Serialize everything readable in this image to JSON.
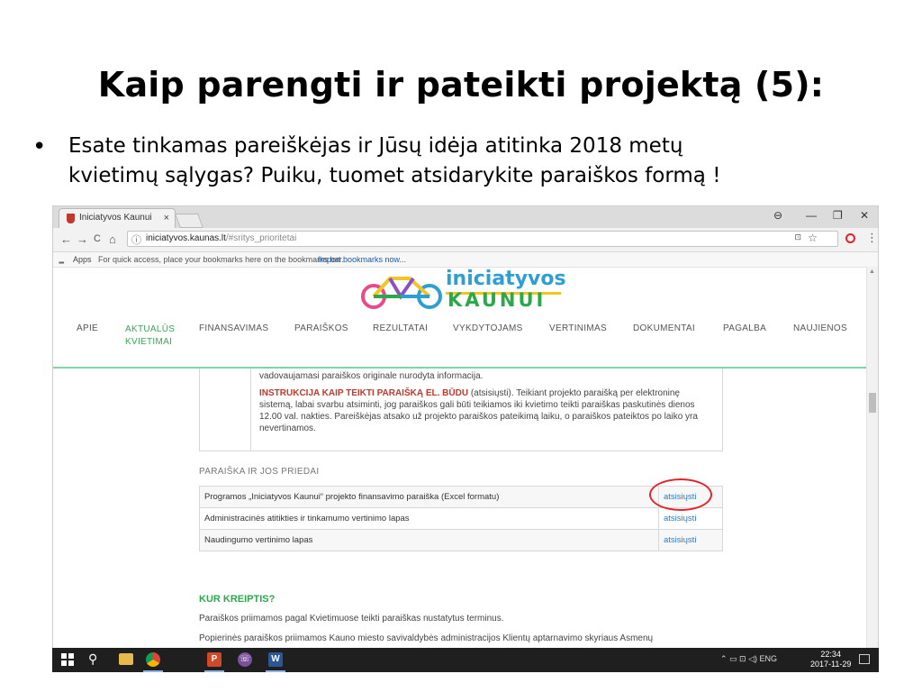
{
  "slide": {
    "title": "Kaip parengti ir pateikti projektą (5):",
    "bullet_symbol": "•",
    "bullet_line1": "Esate tinkamas pareiškėjas ir Jūsų idėja atitinka 2018 metų",
    "bullet_line2": "kvietimų sąlygas?  Puiku, tuomet atsidarykite paraiškos formą !"
  },
  "browser": {
    "tab_title": "Iniciatyvos Kaunui",
    "tab_close": "×",
    "window_controls": [
      "⊖",
      "—",
      "❐",
      "✕"
    ],
    "back": "←",
    "forward": "→",
    "reload": "C",
    "home": "⌂",
    "info_icon": "ⓘ",
    "url_host": "iniciatyvos.kaunas.lt",
    "url_path": "/#sritys_prioritetai",
    "translate_icon": "⊡",
    "star": "☆",
    "menu": "⋮",
    "bookmarks": {
      "apps_icon": "▪▪▪",
      "apps_label": "Apps",
      "hint": "For quick access, place your bookmarks here on the bookmarks bar.",
      "import": "Import bookmarks now..."
    }
  },
  "site": {
    "logo_line1": "iniciatyvos",
    "logo_line2": "KAUNUI",
    "nav": [
      {
        "label": "APIE"
      },
      {
        "label_line1": "AKTUALŪS",
        "label_line2": "KVIETIMAI"
      },
      {
        "label": "FINANSAVIMAS"
      },
      {
        "label": "PARAIŠKOS"
      },
      {
        "label": "REZULTATAI"
      },
      {
        "label": "VYKDYTOJAMS"
      },
      {
        "label": "VERTINIMAS"
      },
      {
        "label": "DOKUMENTAI"
      },
      {
        "label": "PAGALBA"
      },
      {
        "label": "NAUJIENOS"
      }
    ],
    "info": {
      "line1": "vadovaujamasi paraiškos originale nurodyta informacija.",
      "instr_title": "INSTRUKCIJA KAIP TEIKTI PARAIŠKĄ EL. BŪDU",
      "instr_link": " (atsisiųsti).",
      "instr_rest": " Teikiant projekto paraišką per elektroninę sistemą, labai svarbu atsiminti, jog paraiškos gali būti teikiamos iki kvietimo teikti paraiškas paskutinės dienos 12.00 val. nakties. Pareiškėjas atsako už projekto paraiškos pateikimą laiku, o paraiškos pateiktos po laiko yra nevertinamos."
    },
    "section_title": "PARAIŠKA IR JOS PRIEDAI",
    "files": [
      {
        "name": "Programos „Iniciatyvos Kaunui“ projekto finansavimo paraiška (Excel formatu)",
        "link": "atsisiųsti"
      },
      {
        "name": "Administracinės atitikties ir tinkamumo vertinimo lapas",
        "link": "atsisiųsti"
      },
      {
        "name": "Naudingumo vertinimo lapas",
        "link": "atsisiųsti"
      }
    ],
    "kur_title": "KUR KREIPTIS?",
    "para1": "Paraiškos priimamos pagal Kvietimuose teikti paraiškas nustatytus terminus.",
    "para2": "Popierinės paraiškos priimamos Kauno miesto savivaldybės administracijos Klientų aptarnavimo skyriaus Asmenų"
  },
  "taskbar": {
    "search_icon": "⚲",
    "powerpoint": "P",
    "viber": "☏",
    "word": "W",
    "tray": "⌃  ▭  ⊡  ◁)  ENG",
    "time": "22:34",
    "date": "2017-11-29"
  },
  "colors": {
    "accent_green": "#2aa84a",
    "accent_blue": "#2f9fd2",
    "link_blue": "#2b7cc0",
    "annotation_red": "#e3242b"
  }
}
